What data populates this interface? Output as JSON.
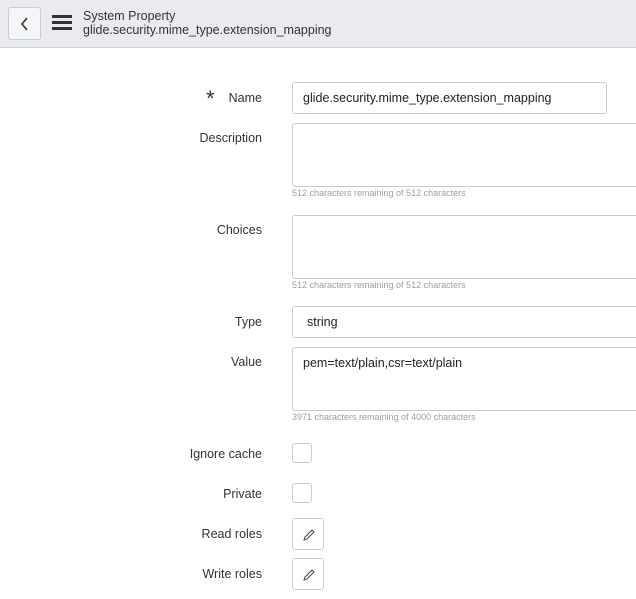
{
  "header": {
    "title": "System Property",
    "subtitle": "glide.security.mime_type.extension_mapping"
  },
  "form": {
    "name": {
      "label": "Name",
      "value": "glide.security.mime_type.extension_mapping",
      "required": true
    },
    "description": {
      "label": "Description",
      "value": "",
      "hint": "512 characters remaining of 512 characters"
    },
    "choices": {
      "label": "Choices",
      "value": "",
      "hint": "512 characters remaining of 512 characters"
    },
    "type": {
      "label": "Type",
      "value": "string"
    },
    "value": {
      "label": "Value",
      "value": "pem=text/plain,csr=text/plain",
      "hint": "3971 characters remaining of 4000 characters"
    },
    "ignore_cache": {
      "label": "Ignore cache",
      "checked": false
    },
    "private": {
      "label": "Private",
      "checked": false
    },
    "read_roles": {
      "label": "Read roles"
    },
    "write_roles": {
      "label": "Write roles"
    }
  }
}
